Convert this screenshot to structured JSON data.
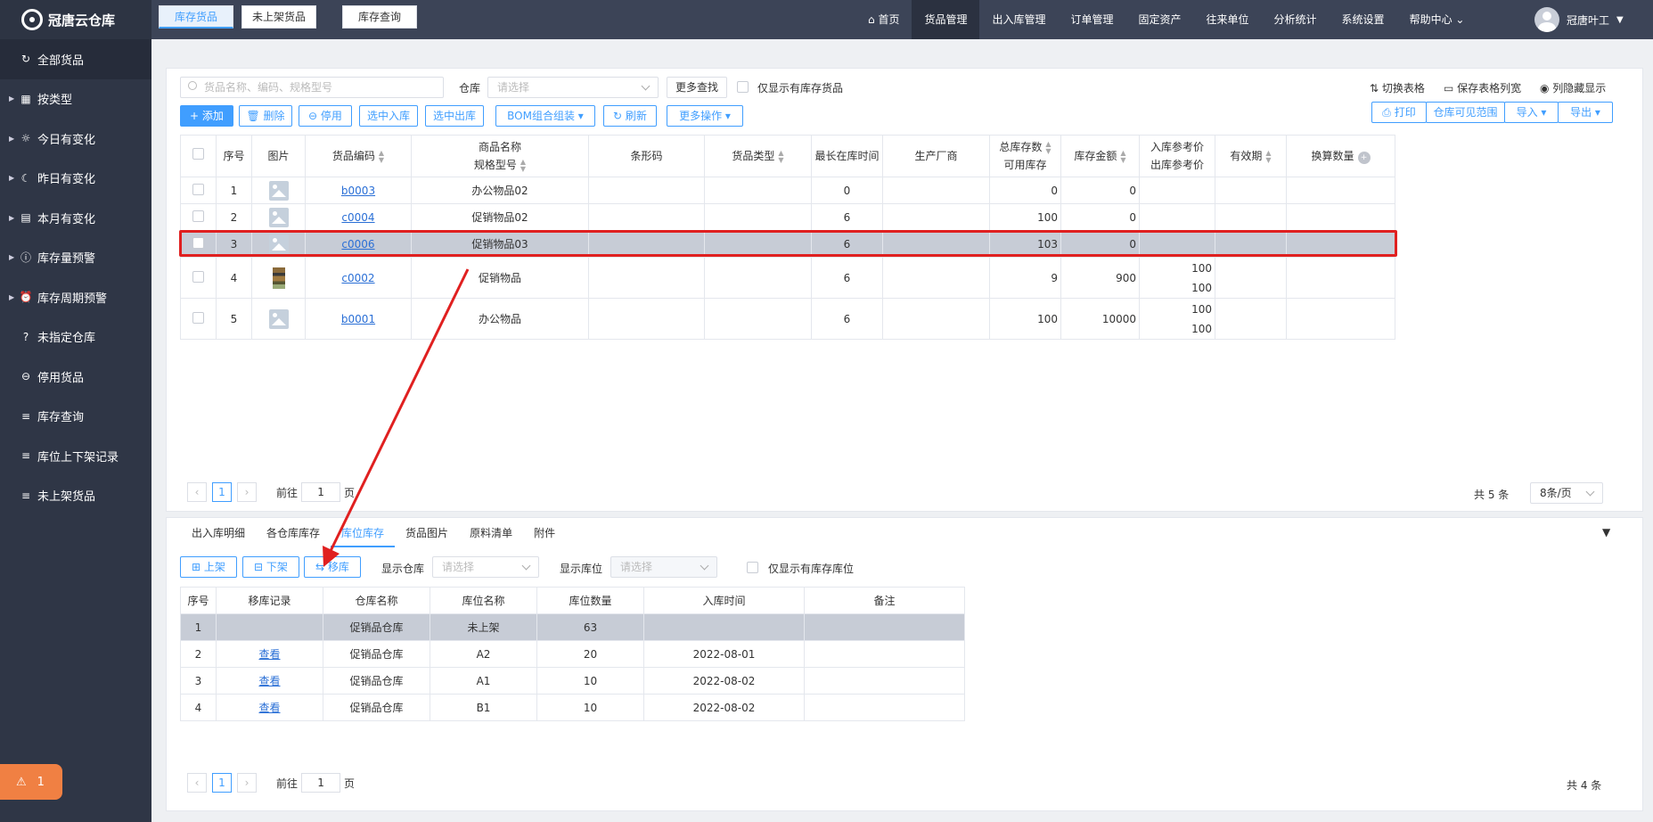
{
  "app": {
    "title": "冠唐云仓库"
  },
  "nav": {
    "home": "首页",
    "items": [
      "货品管理",
      "出入库管理",
      "订单管理",
      "固定资产",
      "往来单位",
      "分析统计",
      "系统设置"
    ],
    "help": "帮助中心",
    "user": "冠唐叶工"
  },
  "sidebar": {
    "items": [
      "全部货品",
      "按类型",
      "今日有变化",
      "昨日有变化",
      "本月有变化",
      "库存量预警",
      "库存周期预警",
      "未指定仓库",
      "停用货品",
      "库存查询",
      "库位上下架记录",
      "未上架货品"
    ],
    "alarm_count": "1"
  },
  "tabs": [
    "库存货品",
    "未上架货品",
    "库存查询"
  ],
  "filter": {
    "search_placeholder": "货品名称、编码、规格型号",
    "warehouse_label": "仓库",
    "warehouse_placeholder": "请选择",
    "more_search": "更多查找",
    "only_stock": "仅显示有库存货品"
  },
  "top_links": [
    "切换表格",
    "保存表格列宽",
    "列隐藏显示"
  ],
  "toolbar": {
    "add": "添加",
    "delete": "删除",
    "disable": "停用",
    "in": "选中入库",
    "out": "选中出库",
    "bom": "BOM组合组装",
    "refresh": "刷新",
    "more": "更多操作",
    "print": "打印",
    "visible": "仓库可见范围",
    "import": "导入",
    "export": "导出"
  },
  "goods_table": {
    "headers": {
      "no": "序号",
      "img": "图片",
      "code": "货品编码",
      "name1": "商品名称",
      "name2": "规格型号",
      "barcode": "条形码",
      "type": "货品类型",
      "maxtime": "最长在库时间",
      "maker": "生产厂商",
      "total1": "总库存数",
      "total2": "可用库存",
      "amount": "库存金额",
      "price1": "入库参考价",
      "price2": "出库参考价",
      "expiry": "有效期",
      "convert": "换算数量"
    },
    "rows": [
      {
        "no": "1",
        "code": "b0003",
        "name": "办公物品02",
        "maxtime": "0",
        "total": "0",
        "amount": "0",
        "p_in": "",
        "p_out": ""
      },
      {
        "no": "2",
        "code": "c0004",
        "name": "促销物品02",
        "maxtime": "6",
        "total": "100",
        "amount": "0",
        "p_in": "",
        "p_out": ""
      },
      {
        "no": "3",
        "code": "c0006",
        "name": "促销物品03",
        "maxtime": "6",
        "total": "103",
        "amount": "0",
        "p_in": "",
        "p_out": ""
      },
      {
        "no": "4",
        "code": "c0002",
        "name": "促销物品",
        "maxtime": "6",
        "total": "9",
        "amount": "900",
        "p_in": "100",
        "p_out": "100"
      },
      {
        "no": "5",
        "code": "b0001",
        "name": "办公物品",
        "maxtime": "6",
        "total": "100",
        "amount": "10000",
        "p_in": "100",
        "p_out": "100"
      }
    ]
  },
  "pager1": {
    "page": "1",
    "goto": "前往",
    "page_unit": "页",
    "total": "共 5 条",
    "per_page": "8条/页"
  },
  "bottom_tabs": [
    "出入库明细",
    "各仓库库存",
    "库位库存",
    "货品图片",
    "原料清单",
    "附件"
  ],
  "bottom_toolbar": {
    "shelve": "上架",
    "unshelve": "下架",
    "move": "移库",
    "show_wh": "显示仓库",
    "wh_placeholder": "请选择",
    "show_loc": "显示库位",
    "loc_placeholder": "请选择",
    "only_loc": "仅显示有库存库位"
  },
  "loc_table": {
    "headers": [
      "序号",
      "移库记录",
      "仓库名称",
      "库位名称",
      "库位数量",
      "入库时间",
      "备注"
    ],
    "rows": [
      {
        "no": "1",
        "record": "",
        "wh": "促销品仓库",
        "loc": "未上架",
        "qty": "63",
        "time": "",
        "note": ""
      },
      {
        "no": "2",
        "record": "查看",
        "wh": "促销品仓库",
        "loc": "A2",
        "qty": "20",
        "time": "2022-08-01",
        "note": ""
      },
      {
        "no": "3",
        "record": "查看",
        "wh": "促销品仓库",
        "loc": "A1",
        "qty": "10",
        "time": "2022-08-02",
        "note": ""
      },
      {
        "no": "4",
        "record": "查看",
        "wh": "促销品仓库",
        "loc": "B1",
        "qty": "10",
        "time": "2022-08-02",
        "note": ""
      }
    ]
  },
  "pager2": {
    "page": "1",
    "goto": "前往",
    "page_unit": "页",
    "total": "共 4 条"
  },
  "colors": {
    "accent": "#409eff",
    "sidebar": "#2f3646",
    "topbar": "#3c4457",
    "highlight": "#e02020",
    "alarm": "#f08043"
  }
}
